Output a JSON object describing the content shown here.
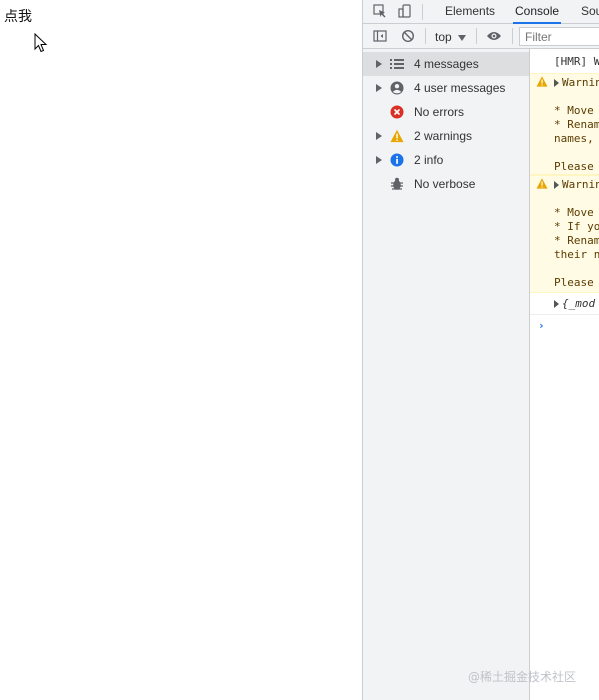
{
  "page": {
    "button_label": "点我"
  },
  "devtools": {
    "tabs": [
      {
        "label": "Elements"
      },
      {
        "label": "Console"
      },
      {
        "label": "Sou"
      }
    ],
    "toolbar": {
      "context": "top",
      "filter_placeholder": "Filter"
    },
    "sidebar": {
      "items": [
        {
          "label": "4 messages",
          "icon": "list-icon"
        },
        {
          "label": "4 user messages",
          "icon": "user-icon"
        },
        {
          "label": "No errors",
          "icon": "error-icon"
        },
        {
          "label": "2 warnings",
          "icon": "warning-icon"
        },
        {
          "label": "2 info",
          "icon": "info-icon"
        },
        {
          "label": "No verbose",
          "icon": "bug-icon"
        }
      ]
    },
    "console": {
      "line_hmr": "[HMR] W",
      "warning1": {
        "head": "Warnin",
        "l1": "* Move",
        "l2": "* Renam",
        "l3": "names,",
        "l4": "Please"
      },
      "warning2": {
        "head": "Warnin",
        "l1": "* Move",
        "l2": "* If yo",
        "l3": "* Renam",
        "l4": "their n",
        "l5": "Please"
      },
      "object_line": "{_mod"
    },
    "colors": {
      "accent": "#1a73e8",
      "warning_bg": "#fffbe5",
      "error": "#d93025",
      "warning": "#e8a600",
      "info": "#1a73e8"
    }
  },
  "watermark": "@稀土掘金技术社区"
}
